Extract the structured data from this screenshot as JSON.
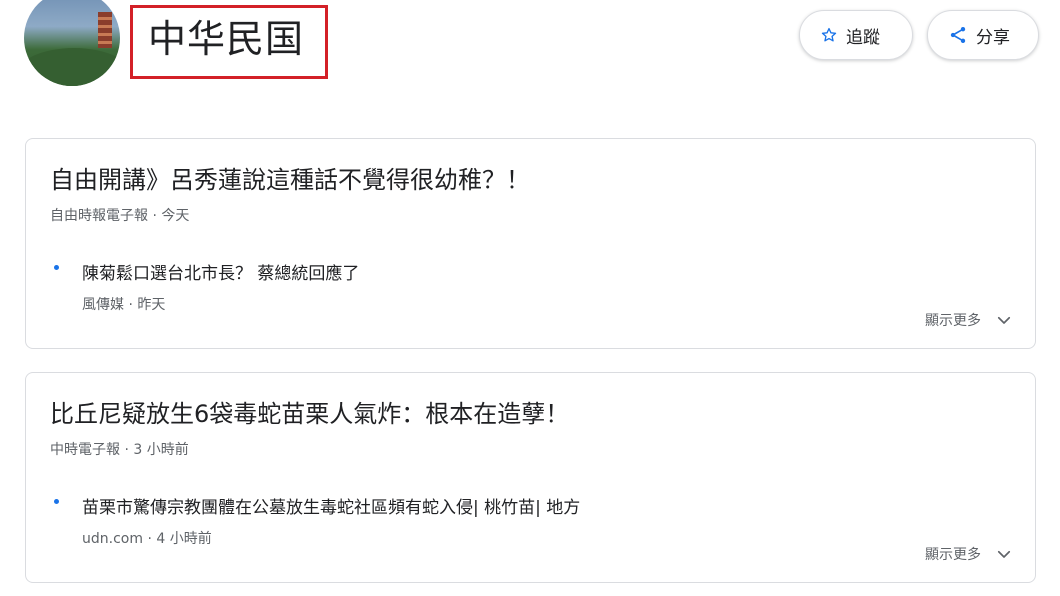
{
  "topic": {
    "title": "中华民国",
    "follow_label": "追蹤",
    "share_label": "分享",
    "icons": {
      "avatar": "topic-avatar-image",
      "follow": "star-icon",
      "share": "share-icon"
    }
  },
  "stories": [
    {
      "headline": "自由開講》呂秀蓮說這種話不覺得很幼稚？！",
      "source": "自由時報電子報",
      "time": "今天",
      "related": {
        "headline": "陳菊鬆口選台北市長？ 蔡總統回應了",
        "source": "風傳媒",
        "time": "昨天"
      },
      "show_more": "顯示更多"
    },
    {
      "headline": "比丘尼疑放生6袋毒蛇苗栗人氣炸：根本在造孽！",
      "source": "中時電子報",
      "time": "3 小時前",
      "related": {
        "headline": "苗栗市驚傳宗教團體在公墓放生毒蛇社區頻有蛇入侵| 桃竹苗| 地方",
        "source": "udn.com",
        "time": "4 小時前"
      },
      "show_more": "顯示更多"
    }
  ],
  "colors": {
    "highlight_box": "#d32027",
    "bullet": "#1a73e8",
    "meta_text": "#5f6368"
  }
}
